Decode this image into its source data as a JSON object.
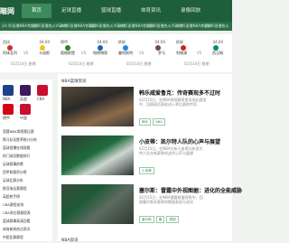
{
  "header": {
    "logo": "瞄网",
    "nav": [
      "首页",
      "足球直播",
      "篮球直播",
      "体育资讯",
      "录像回放"
    ]
  },
  "ticker": [
    "24:45直播NBA常规赛",
    "14:00直播热火VS灰熊",
    "24:45直播NBA常规赛",
    "14:00直播热火VS灰熊",
    "24:45直播NBA常规赛",
    "14:00直播热火VS灰熊",
    "24:45直播NBA常规赛",
    "14:00直播热火"
  ],
  "matches": [
    {
      "league": "西班",
      "time": "04:00",
      "t1": "阿体瓦列",
      "vs": "VS",
      "t2": "卡迪斯",
      "date": "02月14日 星期"
    },
    {
      "league": "德甲",
      "time": "04:00",
      "t1": "奥格斯堡",
      "vs": "VS",
      "t2": "帕德博恩",
      "date": "02月14日 星期"
    },
    {
      "league": "欧联",
      "time": "04:00",
      "t1": "曼彻斯特",
      "vs": "VS",
      "t2": "罗马",
      "date": "02月14日 星期"
    },
    {
      "league": "欧联",
      "time": "04:00",
      "t1": "利物浦",
      "vs": "VS",
      "t2": "西汉姆",
      "date": "02月14日 星期"
    }
  ],
  "leagues": [
    {
      "name": "NBA",
      "color": "#1d428a"
    },
    {
      "name": "英超",
      "color": "#3d195b"
    },
    {
      "name": "CBA",
      "color": "#c8102e"
    },
    {
      "name": "德甲",
      "color": "#d20515"
    },
    {
      "name": "中超",
      "color": "#c8102e"
    }
  ],
  "sidebar_links": [
    "竞猜NBA常规赛比赛",
    "黑马队伍胜率统计分析",
    "篮球直播在线观看",
    "热门球员数据排行",
    "足球赛事前瞻",
    "西甲联赛积分榜",
    "足球比赛分析",
    "欧冠淘汰赛赛程",
    "英超射手榜",
    "CBA赛程安排",
    "CBA季后赛赛程表",
    "篮球赛事高清回看",
    "体育新闻热点资讯",
    "中超比赛赛程"
  ],
  "section_title": "NBA篮球资讯",
  "articles": [
    {
      "title": "韩乐威爱鲁克：传奇赛现多不过时",
      "meta1": "02月15日，在NBA常规赛季里多场比赛里",
      "meta2": "中，回顾球员表现进入季后赛的传奇",
      "tags": [
        "韩乐",
        "NBA"
      ]
    },
    {
      "title": "小皮蒂：凯尔特人队的心声与展望",
      "meta1": "02月15日，在NBA分析小皮蒂分析凯尔",
      "meta2": "特人队在新赛季的战术心声与展望",
      "tags": [
        "小皮蒂"
      ]
    },
    {
      "title": "塞尔斯：雷霆中外视图据：进化的全能威胁",
      "meta1": "02月15日，在NBA雷霆联盟视角中，回",
      "meta2": "顾塞尔斯本赛季的数据表现与进化",
      "tags": [
        "塞尔斯",
        "雷",
        "视图"
      ]
    }
  ],
  "bottom_section_title": "NBA资讯"
}
